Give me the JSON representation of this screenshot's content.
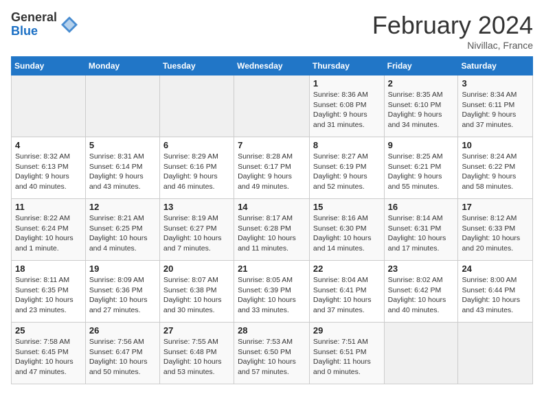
{
  "header": {
    "logo_general": "General",
    "logo_blue": "Blue",
    "title": "February 2024",
    "location": "Nivillac, France"
  },
  "days_of_week": [
    "Sunday",
    "Monday",
    "Tuesday",
    "Wednesday",
    "Thursday",
    "Friday",
    "Saturday"
  ],
  "weeks": [
    [
      {
        "num": "",
        "info": ""
      },
      {
        "num": "",
        "info": ""
      },
      {
        "num": "",
        "info": ""
      },
      {
        "num": "",
        "info": ""
      },
      {
        "num": "1",
        "info": "Sunrise: 8:36 AM\nSunset: 6:08 PM\nDaylight: 9 hours and 31 minutes."
      },
      {
        "num": "2",
        "info": "Sunrise: 8:35 AM\nSunset: 6:10 PM\nDaylight: 9 hours and 34 minutes."
      },
      {
        "num": "3",
        "info": "Sunrise: 8:34 AM\nSunset: 6:11 PM\nDaylight: 9 hours and 37 minutes."
      }
    ],
    [
      {
        "num": "4",
        "info": "Sunrise: 8:32 AM\nSunset: 6:13 PM\nDaylight: 9 hours and 40 minutes."
      },
      {
        "num": "5",
        "info": "Sunrise: 8:31 AM\nSunset: 6:14 PM\nDaylight: 9 hours and 43 minutes."
      },
      {
        "num": "6",
        "info": "Sunrise: 8:29 AM\nSunset: 6:16 PM\nDaylight: 9 hours and 46 minutes."
      },
      {
        "num": "7",
        "info": "Sunrise: 8:28 AM\nSunset: 6:17 PM\nDaylight: 9 hours and 49 minutes."
      },
      {
        "num": "8",
        "info": "Sunrise: 8:27 AM\nSunset: 6:19 PM\nDaylight: 9 hours and 52 minutes."
      },
      {
        "num": "9",
        "info": "Sunrise: 8:25 AM\nSunset: 6:21 PM\nDaylight: 9 hours and 55 minutes."
      },
      {
        "num": "10",
        "info": "Sunrise: 8:24 AM\nSunset: 6:22 PM\nDaylight: 9 hours and 58 minutes."
      }
    ],
    [
      {
        "num": "11",
        "info": "Sunrise: 8:22 AM\nSunset: 6:24 PM\nDaylight: 10 hours and 1 minute."
      },
      {
        "num": "12",
        "info": "Sunrise: 8:21 AM\nSunset: 6:25 PM\nDaylight: 10 hours and 4 minutes."
      },
      {
        "num": "13",
        "info": "Sunrise: 8:19 AM\nSunset: 6:27 PM\nDaylight: 10 hours and 7 minutes."
      },
      {
        "num": "14",
        "info": "Sunrise: 8:17 AM\nSunset: 6:28 PM\nDaylight: 10 hours and 11 minutes."
      },
      {
        "num": "15",
        "info": "Sunrise: 8:16 AM\nSunset: 6:30 PM\nDaylight: 10 hours and 14 minutes."
      },
      {
        "num": "16",
        "info": "Sunrise: 8:14 AM\nSunset: 6:31 PM\nDaylight: 10 hours and 17 minutes."
      },
      {
        "num": "17",
        "info": "Sunrise: 8:12 AM\nSunset: 6:33 PM\nDaylight: 10 hours and 20 minutes."
      }
    ],
    [
      {
        "num": "18",
        "info": "Sunrise: 8:11 AM\nSunset: 6:35 PM\nDaylight: 10 hours and 23 minutes."
      },
      {
        "num": "19",
        "info": "Sunrise: 8:09 AM\nSunset: 6:36 PM\nDaylight: 10 hours and 27 minutes."
      },
      {
        "num": "20",
        "info": "Sunrise: 8:07 AM\nSunset: 6:38 PM\nDaylight: 10 hours and 30 minutes."
      },
      {
        "num": "21",
        "info": "Sunrise: 8:05 AM\nSunset: 6:39 PM\nDaylight: 10 hours and 33 minutes."
      },
      {
        "num": "22",
        "info": "Sunrise: 8:04 AM\nSunset: 6:41 PM\nDaylight: 10 hours and 37 minutes."
      },
      {
        "num": "23",
        "info": "Sunrise: 8:02 AM\nSunset: 6:42 PM\nDaylight: 10 hours and 40 minutes."
      },
      {
        "num": "24",
        "info": "Sunrise: 8:00 AM\nSunset: 6:44 PM\nDaylight: 10 hours and 43 minutes."
      }
    ],
    [
      {
        "num": "25",
        "info": "Sunrise: 7:58 AM\nSunset: 6:45 PM\nDaylight: 10 hours and 47 minutes."
      },
      {
        "num": "26",
        "info": "Sunrise: 7:56 AM\nSunset: 6:47 PM\nDaylight: 10 hours and 50 minutes."
      },
      {
        "num": "27",
        "info": "Sunrise: 7:55 AM\nSunset: 6:48 PM\nDaylight: 10 hours and 53 minutes."
      },
      {
        "num": "28",
        "info": "Sunrise: 7:53 AM\nSunset: 6:50 PM\nDaylight: 10 hours and 57 minutes."
      },
      {
        "num": "29",
        "info": "Sunrise: 7:51 AM\nSunset: 6:51 PM\nDaylight: 11 hours and 0 minutes."
      },
      {
        "num": "",
        "info": ""
      },
      {
        "num": "",
        "info": ""
      }
    ]
  ]
}
